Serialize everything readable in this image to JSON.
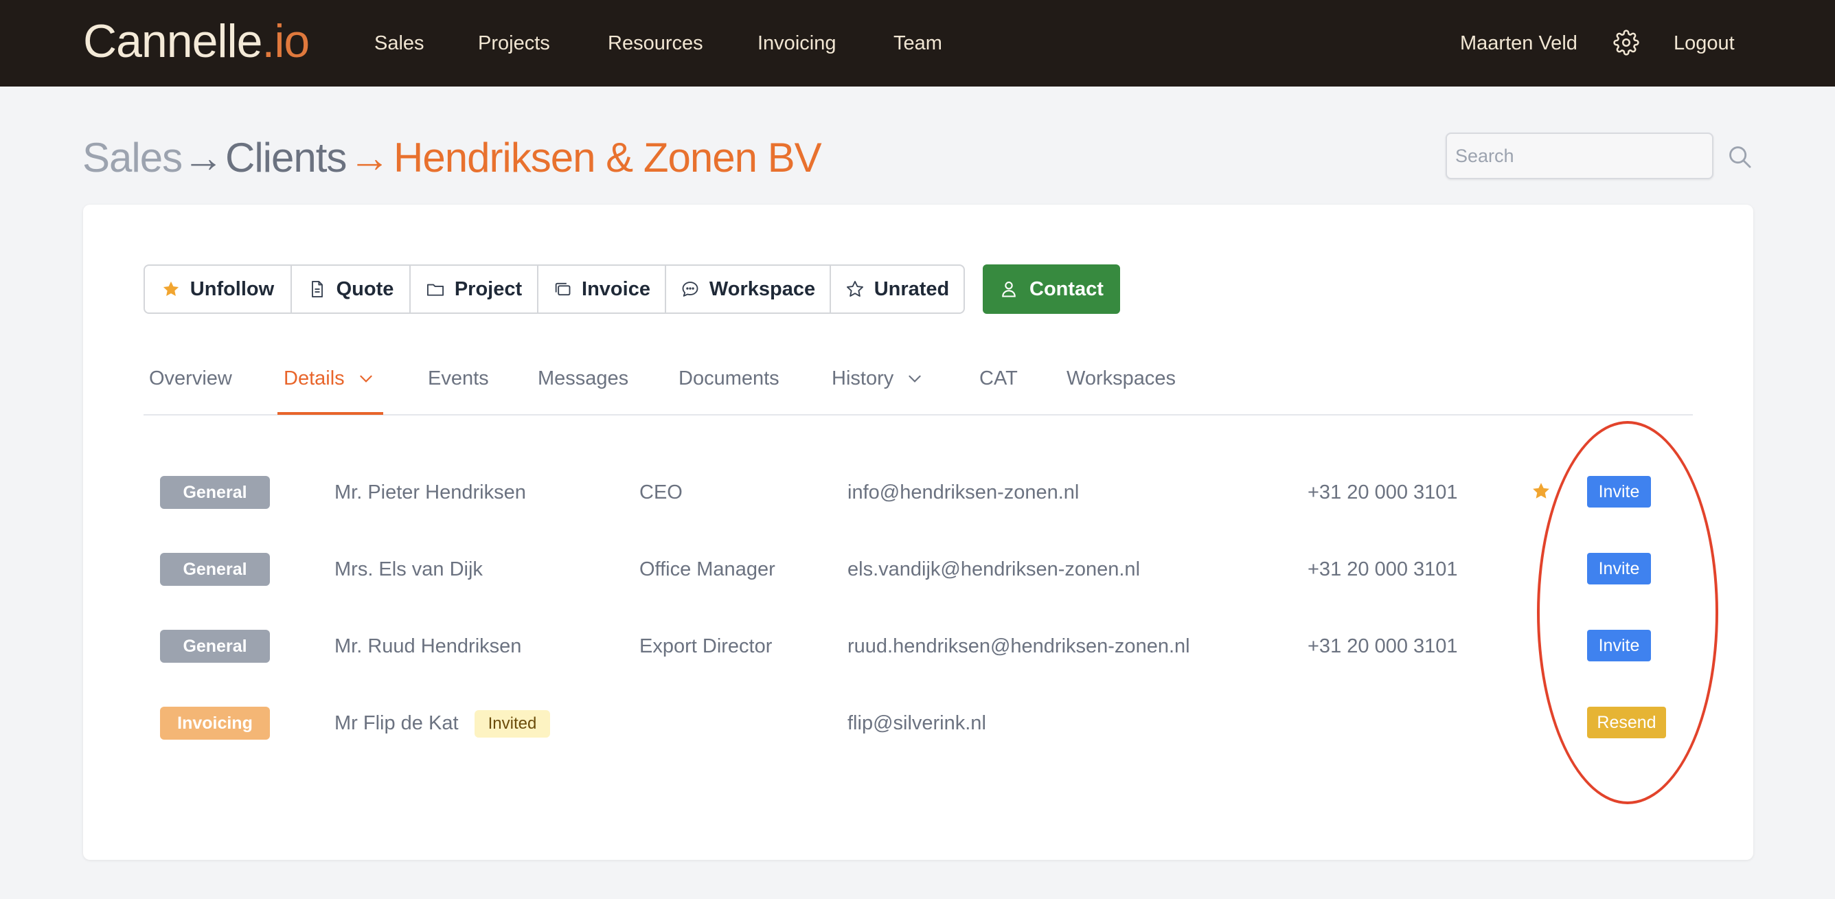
{
  "nav": {
    "brand": "Cannelle",
    "brand_suffix": ".io",
    "links": [
      "Sales",
      "Projects",
      "Resources",
      "Invoicing",
      "Team"
    ],
    "user": "Maarten Veld",
    "settings_icon": "gear-icon",
    "logout": "Logout"
  },
  "breadcrumb": {
    "level1": "Sales",
    "level2": "Clients",
    "current": "Hendriksen & Zonen BV",
    "separator": "→"
  },
  "search": {
    "placeholder": "Search"
  },
  "actions": {
    "unfollow": "Unfollow",
    "quote": "Quote",
    "project": "Project",
    "invoice": "Invoice",
    "workspace": "Workspace",
    "unrated": "Unrated",
    "contact": "Contact"
  },
  "tabs": [
    "Overview",
    "Details",
    "Events",
    "Messages",
    "Documents",
    "History",
    "CAT",
    "Workspaces"
  ],
  "active_tab": "Details",
  "contacts": [
    {
      "category": "General",
      "name": "Mr. Pieter Hendriksen",
      "role": "CEO",
      "email": "info@hendriksen-zonen.nl",
      "phone": "+31 20 000 3101",
      "primary": true,
      "action": "Invite"
    },
    {
      "category": "General",
      "name": "Mrs. Els van Dijk",
      "role": "Office Manager",
      "email": "els.vandijk@hendriksen-zonen.nl",
      "phone": "+31 20 000 3101",
      "primary": false,
      "action": "Invite"
    },
    {
      "category": "General",
      "name": "Mr. Ruud Hendriksen",
      "role": "Export Director",
      "email": "ruud.hendriksen@hendriksen-zonen.nl",
      "phone": "+31 20 000 3101",
      "primary": false,
      "action": "Invite"
    },
    {
      "category": "Invoicing",
      "name": "Mr Flip de Kat",
      "status": "Invited",
      "role": "",
      "email": "flip@silverink.nl",
      "phone": "",
      "primary": false,
      "action": "Resend"
    }
  ],
  "colors": {
    "accent": "#e8712e",
    "nav_bg": "#211b17",
    "contact_green": "#378a3f",
    "invite_blue": "#3f82ef",
    "resend_yellow": "#e6b434",
    "annotation_red": "#e2432b"
  }
}
